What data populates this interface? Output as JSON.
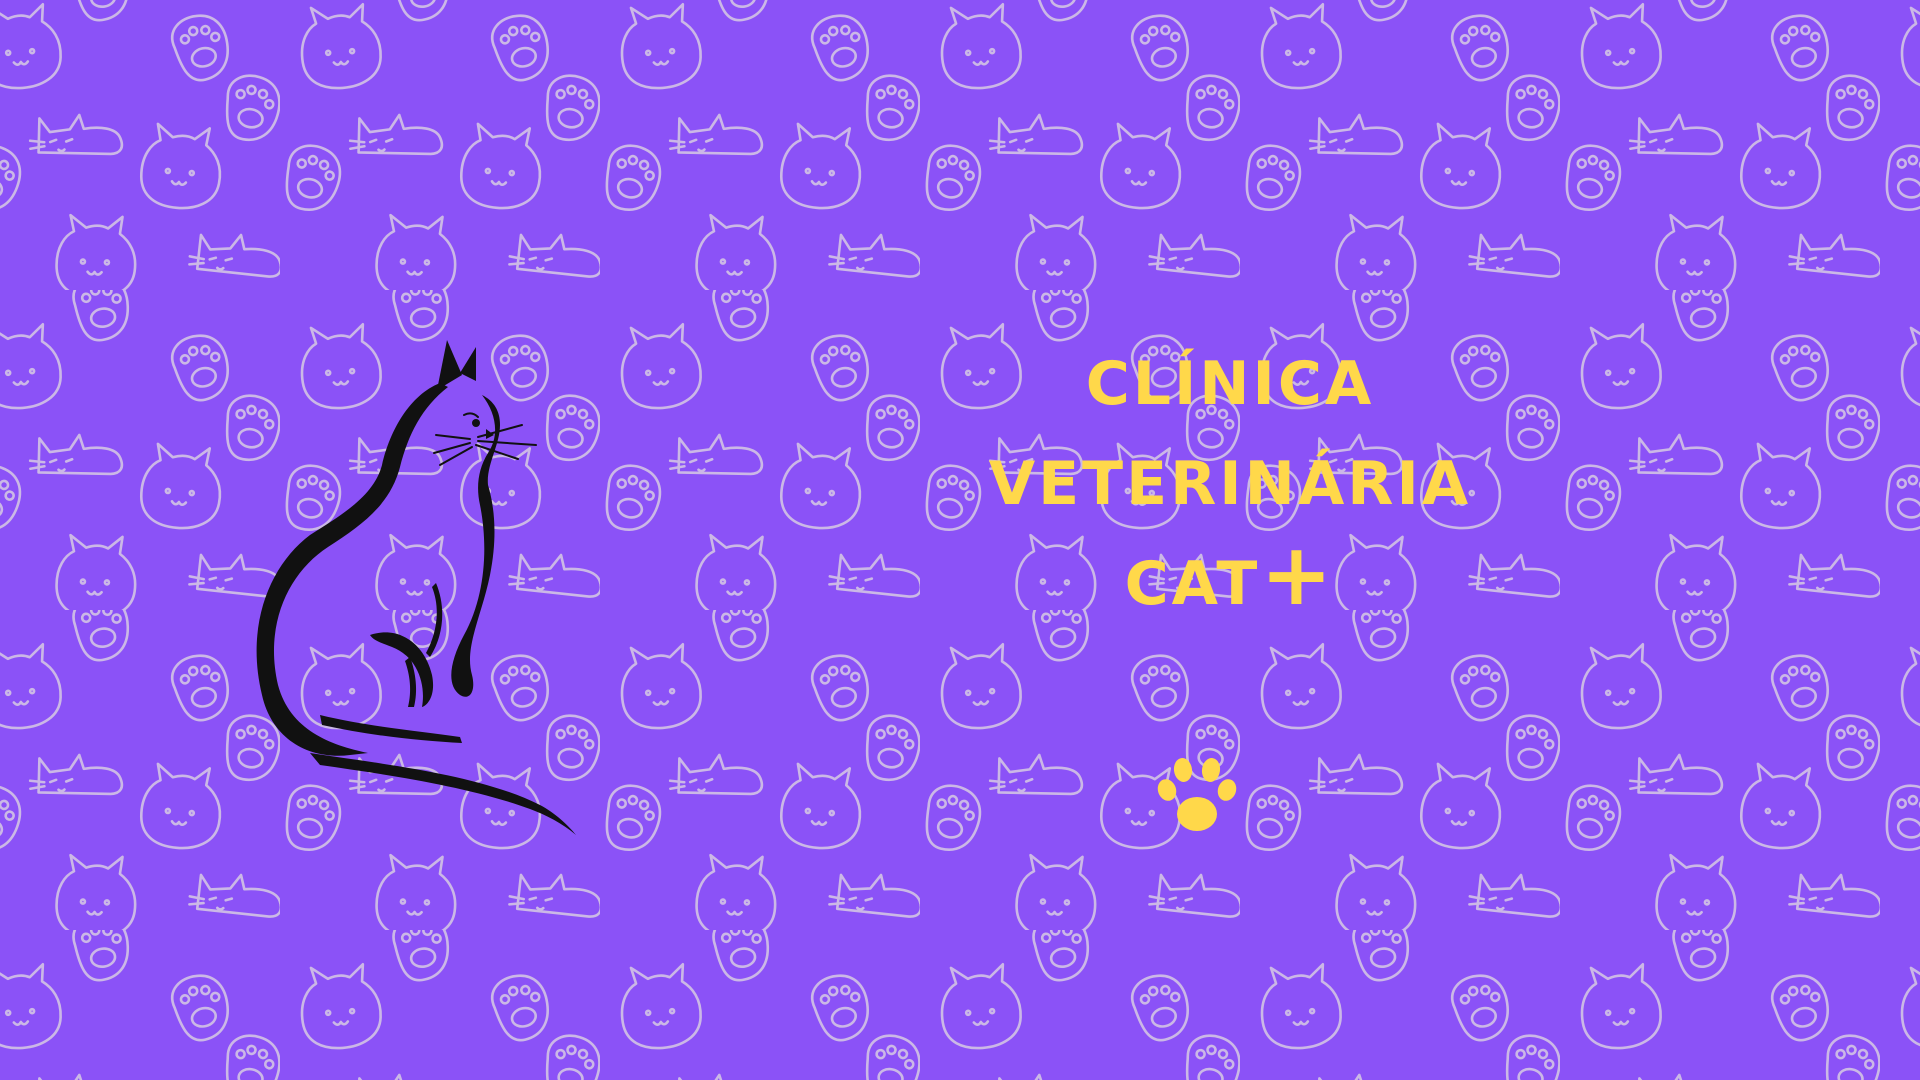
{
  "title": {
    "line1": "CLÍNICA",
    "line2": "VETERINÁRIA",
    "line3": "CAT+"
  },
  "colors": {
    "background": "#8b52f7",
    "pattern_stroke": "#cbb8e6",
    "title": "#ffd84a",
    "paw": "#ffd84a",
    "silhouette": "#111111"
  },
  "icons": {
    "background": "cat-face-and-paw-doodle-pattern",
    "silhouette": "sitting-cat-silhouette-icon",
    "paw": "paw-print-icon"
  }
}
